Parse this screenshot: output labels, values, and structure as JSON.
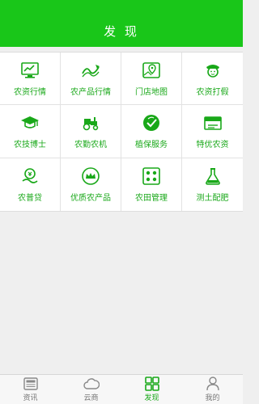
{
  "header": {
    "title": "发 现"
  },
  "grid": {
    "items": [
      {
        "label": "农资行情",
        "icon": "monitor-chart-icon"
      },
      {
        "label": "农产品行情",
        "icon": "trend-line-icon"
      },
      {
        "label": "门店地图",
        "icon": "map-pin-icon"
      },
      {
        "label": "农资打假",
        "icon": "police-officer-icon"
      },
      {
        "label": "农技博士",
        "icon": "graduation-cap-icon"
      },
      {
        "label": "农勤农机",
        "icon": "tractor-icon"
      },
      {
        "label": "植保服务",
        "icon": "plant-check-icon"
      },
      {
        "label": "特优农资",
        "icon": "premium-box-icon"
      },
      {
        "label": "农普贷",
        "icon": "loan-coin-icon"
      },
      {
        "label": "优质农产品",
        "icon": "crown-badge-icon"
      },
      {
        "label": "农田管理",
        "icon": "field-grid-icon"
      },
      {
        "label": "测土配肥",
        "icon": "flask-icon"
      }
    ]
  },
  "tabs": [
    {
      "label": "资讯",
      "icon": "news-icon"
    },
    {
      "label": "云商",
      "icon": "cloud-icon"
    },
    {
      "label": "发现",
      "icon": "discover-grid-icon",
      "active": true
    },
    {
      "label": "我的",
      "icon": "user-icon"
    }
  ],
  "colors": {
    "brand": "#19c619",
    "label": "#19a819",
    "inactive": "#777777"
  }
}
